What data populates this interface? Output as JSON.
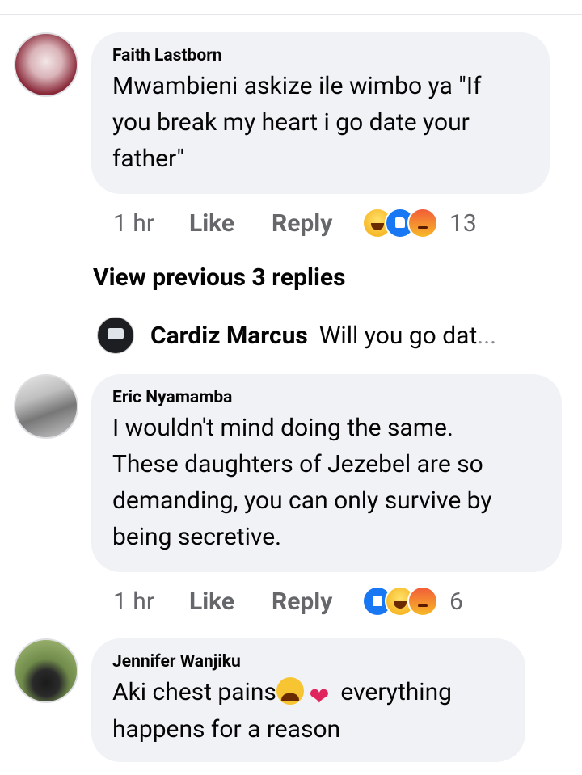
{
  "comments": [
    {
      "author": "Faith Lastborn",
      "text": "Mwambieni askize ile wimbo ya \"If you break my heart i go date your father\"",
      "lines": [
        "Mwambieni askize ile wimbo ya \"If",
        "you break my heart i go date your",
        "father\""
      ],
      "time": "1 hr",
      "like_label": "Like",
      "reply_label": "Reply",
      "reactions": [
        "haha",
        "like",
        "angry"
      ],
      "reaction_count": "13"
    },
    {
      "author": "Eric Nyamamba",
      "lines": [
        "I wouldn't mind doing the same.",
        "These daughters of Jezebel are so",
        "demanding, you can only survive by",
        "being secretive."
      ],
      "time": "1 hr",
      "like_label": "Like",
      "reply_label": "Reply",
      "reactions": [
        "like",
        "haha",
        "angry"
      ],
      "reaction_count": "6"
    },
    {
      "author": "Jennifer Wanjiku",
      "line1": "Aki chest pains",
      "line1_after": " everything",
      "line2": "happens for a reason",
      "emojis": [
        "crying-face",
        "broken-heart"
      ]
    }
  ],
  "view_previous": "View previous 3 replies",
  "inline_reply": {
    "author": "Cardiz Marcus",
    "text": "Will you go dat",
    "ellipsis": "..."
  },
  "colors": {
    "bubble": "#f0f2f5",
    "meta": "#65676b",
    "text": "#050505",
    "like_blue": "#1877f2"
  }
}
